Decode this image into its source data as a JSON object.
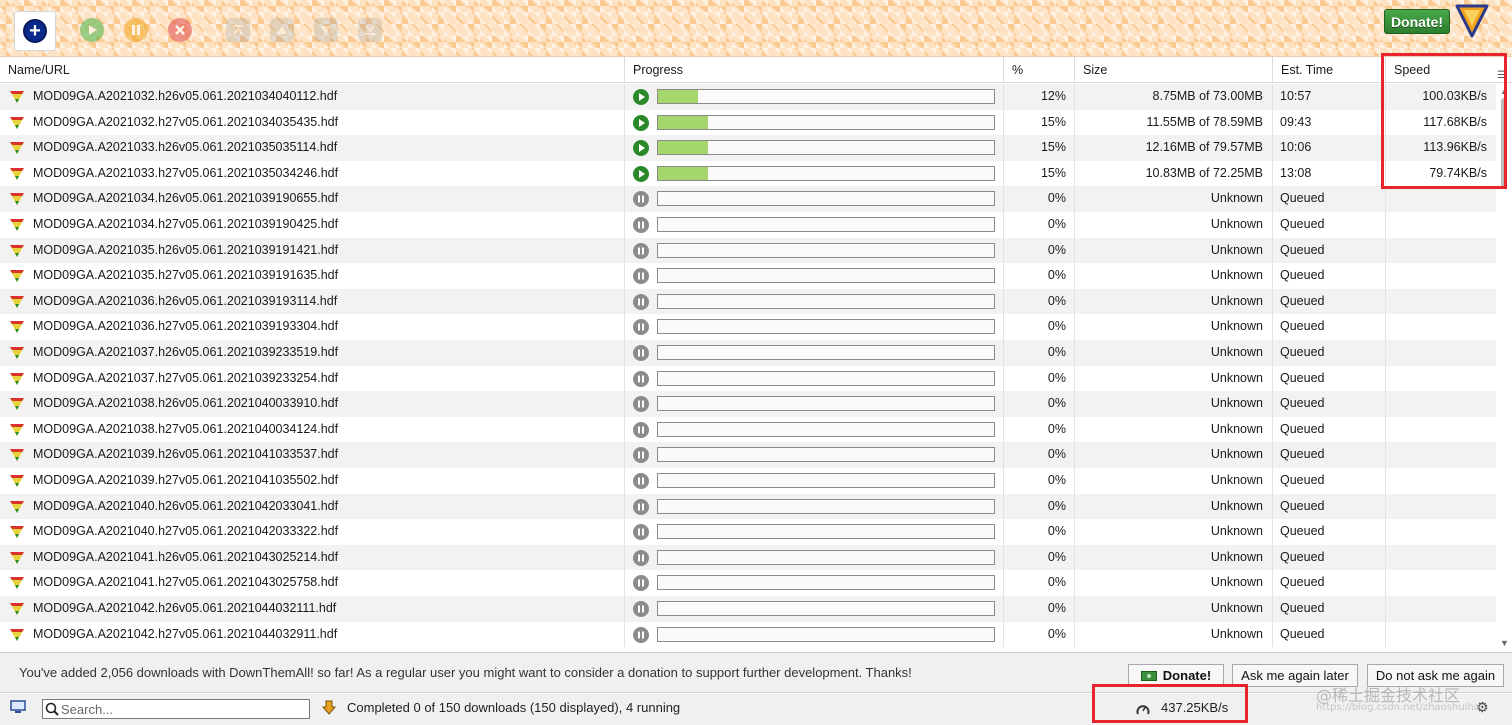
{
  "toolbar": {
    "buttons": [
      "add-icon",
      "resume-icon",
      "pause-icon",
      "cancel-icon",
      "move-top-icon",
      "move-up-icon",
      "move-down-icon",
      "move-bottom-icon"
    ],
    "donate_label": "Donate!"
  },
  "columns": {
    "name": "Name/URL",
    "progress": "Progress",
    "percent": "%",
    "size": "Size",
    "est_time": "Est. Time",
    "speed": "Speed"
  },
  "colors": {
    "progress_fill": "#a5d66b",
    "running": "#2a8a2a",
    "paused": "#8b8b8b",
    "highlight": "#e8242c"
  },
  "rows": [
    {
      "name": "MOD09GA.A2021032.h26v05.061.2021034040112.hdf",
      "status": "running",
      "progress": 0.12,
      "percent": "12%",
      "size": "8.75MB of 73.00MB",
      "time": "10:57",
      "speed": "100.03KB/s"
    },
    {
      "name": "MOD09GA.A2021032.h27v05.061.2021034035435.hdf",
      "status": "running",
      "progress": 0.15,
      "percent": "15%",
      "size": "11.55MB of 78.59MB",
      "time": "09:43",
      "speed": "117.68KB/s"
    },
    {
      "name": "MOD09GA.A2021033.h26v05.061.2021035035114.hdf",
      "status": "running",
      "progress": 0.15,
      "percent": "15%",
      "size": "12.16MB of 79.57MB",
      "time": "10:06",
      "speed": "113.96KB/s"
    },
    {
      "name": "MOD09GA.A2021033.h27v05.061.2021035034246.hdf",
      "status": "running",
      "progress": 0.15,
      "percent": "15%",
      "size": "10.83MB of 72.25MB",
      "time": "13:08",
      "speed": "79.74KB/s"
    },
    {
      "name": "MOD09GA.A2021034.h26v05.061.2021039190655.hdf",
      "status": "paused",
      "progress": 0,
      "percent": "0%",
      "size": "Unknown",
      "time": "Queued",
      "speed": ""
    },
    {
      "name": "MOD09GA.A2021034.h27v05.061.2021039190425.hdf",
      "status": "paused",
      "progress": 0,
      "percent": "0%",
      "size": "Unknown",
      "time": "Queued",
      "speed": ""
    },
    {
      "name": "MOD09GA.A2021035.h26v05.061.2021039191421.hdf",
      "status": "paused",
      "progress": 0,
      "percent": "0%",
      "size": "Unknown",
      "time": "Queued",
      "speed": ""
    },
    {
      "name": "MOD09GA.A2021035.h27v05.061.2021039191635.hdf",
      "status": "paused",
      "progress": 0,
      "percent": "0%",
      "size": "Unknown",
      "time": "Queued",
      "speed": ""
    },
    {
      "name": "MOD09GA.A2021036.h26v05.061.2021039193114.hdf",
      "status": "paused",
      "progress": 0,
      "percent": "0%",
      "size": "Unknown",
      "time": "Queued",
      "speed": ""
    },
    {
      "name": "MOD09GA.A2021036.h27v05.061.2021039193304.hdf",
      "status": "paused",
      "progress": 0,
      "percent": "0%",
      "size": "Unknown",
      "time": "Queued",
      "speed": ""
    },
    {
      "name": "MOD09GA.A2021037.h26v05.061.2021039233519.hdf",
      "status": "paused",
      "progress": 0,
      "percent": "0%",
      "size": "Unknown",
      "time": "Queued",
      "speed": ""
    },
    {
      "name": "MOD09GA.A2021037.h27v05.061.2021039233254.hdf",
      "status": "paused",
      "progress": 0,
      "percent": "0%",
      "size": "Unknown",
      "time": "Queued",
      "speed": ""
    },
    {
      "name": "MOD09GA.A2021038.h26v05.061.2021040033910.hdf",
      "status": "paused",
      "progress": 0,
      "percent": "0%",
      "size": "Unknown",
      "time": "Queued",
      "speed": ""
    },
    {
      "name": "MOD09GA.A2021038.h27v05.061.2021040034124.hdf",
      "status": "paused",
      "progress": 0,
      "percent": "0%",
      "size": "Unknown",
      "time": "Queued",
      "speed": ""
    },
    {
      "name": "MOD09GA.A2021039.h26v05.061.2021041033537.hdf",
      "status": "paused",
      "progress": 0,
      "percent": "0%",
      "size": "Unknown",
      "time": "Queued",
      "speed": ""
    },
    {
      "name": "MOD09GA.A2021039.h27v05.061.2021041035502.hdf",
      "status": "paused",
      "progress": 0,
      "percent": "0%",
      "size": "Unknown",
      "time": "Queued",
      "speed": ""
    },
    {
      "name": "MOD09GA.A2021040.h26v05.061.2021042033041.hdf",
      "status": "paused",
      "progress": 0,
      "percent": "0%",
      "size": "Unknown",
      "time": "Queued",
      "speed": ""
    },
    {
      "name": "MOD09GA.A2021040.h27v05.061.2021042033322.hdf",
      "status": "paused",
      "progress": 0,
      "percent": "0%",
      "size": "Unknown",
      "time": "Queued",
      "speed": ""
    },
    {
      "name": "MOD09GA.A2021041.h26v05.061.2021043025214.hdf",
      "status": "paused",
      "progress": 0,
      "percent": "0%",
      "size": "Unknown",
      "time": "Queued",
      "speed": ""
    },
    {
      "name": "MOD09GA.A2021041.h27v05.061.2021043025758.hdf",
      "status": "paused",
      "progress": 0,
      "percent": "0%",
      "size": "Unknown",
      "time": "Queued",
      "speed": ""
    },
    {
      "name": "MOD09GA.A2021042.h26v05.061.2021044032111.hdf",
      "status": "paused",
      "progress": 0,
      "percent": "0%",
      "size": "Unknown",
      "time": "Queued",
      "speed": ""
    },
    {
      "name": "MOD09GA.A2021042.h27v05.061.2021044032911.hdf",
      "status": "paused",
      "progress": 0,
      "percent": "0%",
      "size": "Unknown",
      "time": "Queued",
      "speed": ""
    }
  ],
  "notification": {
    "message": "You've added 2,056 downloads with DownThemAll! so far! As a regular user you might want to consider a donation to support further development. Thanks!",
    "donate_label": "Donate!",
    "later_label": "Ask me again later",
    "never_label": "Do not ask me again"
  },
  "statusbar": {
    "search_placeholder": "Search...",
    "status_text": "Completed 0 of 150 downloads (150 displayed), 4 running",
    "total_speed": "437.25KB/s"
  },
  "watermark": {
    "text": "@稀土掘金技术社区",
    "url": "https://blog.csdn.net/zhaoshuihan"
  }
}
